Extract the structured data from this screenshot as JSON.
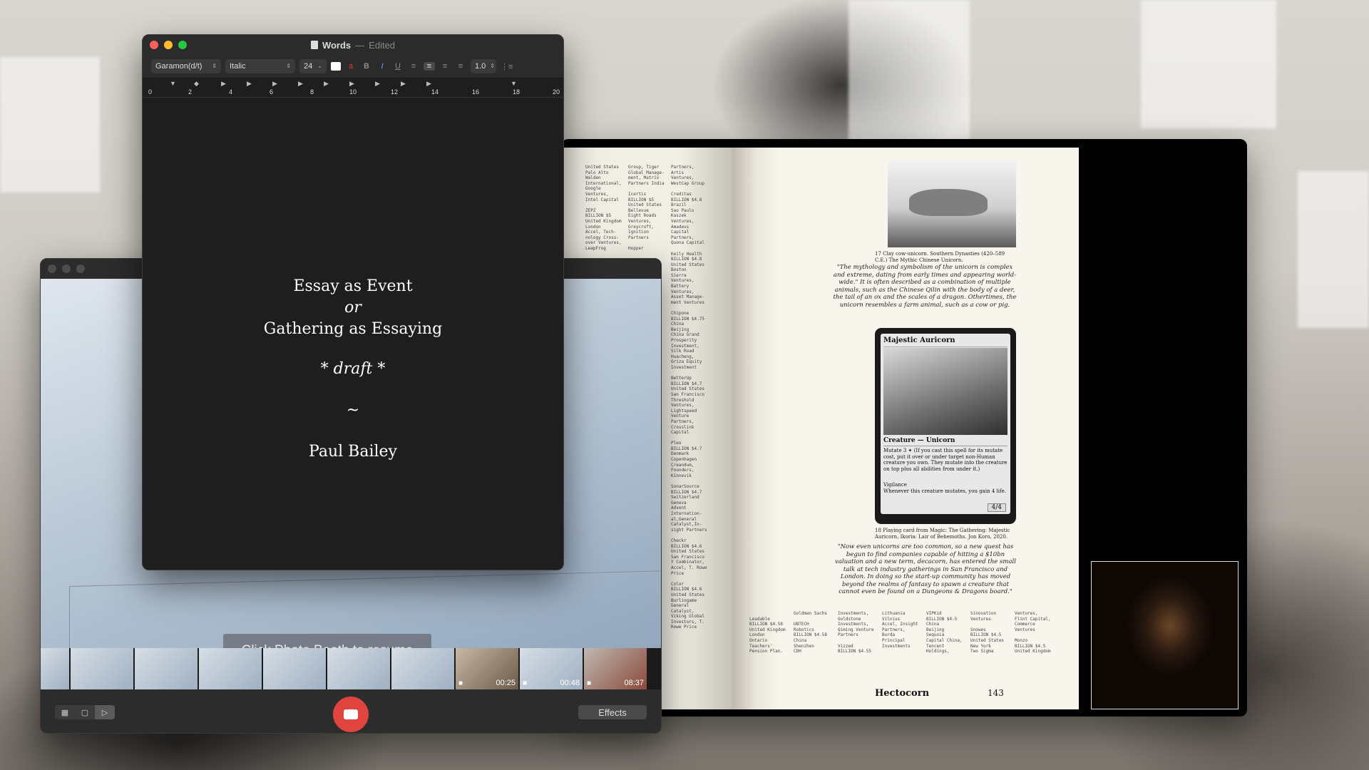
{
  "words": {
    "title": "Words",
    "separator": "—",
    "status": "Edited",
    "toolbar": {
      "font": "Garamon(d/t)",
      "style": "Italic",
      "size": "24",
      "bold": "B",
      "italic": "I",
      "underline": "U",
      "spacing": "1.0"
    },
    "ruler": [
      "0",
      "2",
      "4",
      "6",
      "8",
      "10",
      "12",
      "14",
      "16",
      "18",
      "20"
    ],
    "document": {
      "line1": "Essay as Event",
      "line2": "or",
      "line3": "Gathering as Essaying",
      "line4": "* draft *",
      "line5": "~",
      "line6": "Paul Bailey"
    }
  },
  "photobooth": {
    "resume_message": "Click Photo Booth to resume",
    "effects_label": "Effects",
    "thumbnails": [
      {
        "duration": ""
      },
      {
        "duration": ""
      },
      {
        "duration": ""
      },
      {
        "duration": ""
      },
      {
        "duration": ""
      },
      {
        "duration": ""
      },
      {
        "duration": ""
      },
      {
        "duration": "00:25"
      },
      {
        "duration": "00:48"
      },
      {
        "duration": "08:37"
      }
    ]
  },
  "book": {
    "left_columns": [
      "United States\nPalo Alto\nWalden\nInternational,\nGoogle\nVentures,\nIntel Capital\n\nZEPZ\nBILLION $5\nUnited Kingdom\nLondon\nAccel, Tech-\nnology Cross-\nover Ventures,\nLeapFrog",
      "Group, Tiger\nGlobal Manage-\nment, Matrix\nPartners India\n\nIcertis\nBILLION $5\nUnited States\nBellevue\nEight Roads\nVentures,\nGreycroft,\nIgnition\nPartners\n\nHopper",
      "Partners,\nArtis\nVentures,\nWestCap Group\n\nCreditas\nBILLION $4.8\nBrazil\nSao Paulo\nKaszek\nVentures,\nAmadeus\nCapital\nPartners,\nQuona Capital\n\nKeily Health\nBILLION $4.8\nUnited States\nBoston\nSierra\nVentures,\nBattery\nVentures,\nAsset Manage-\nment Ventures\n\nChipone\nBILLION $4.75\nChina\nBeijing\nChina Grand\nProsperity\nInvestment,\nSilk Road\nHuacheng,\nOriza Equity\nInvestment\n\nBetterUp\nBILLION $4.7\nUnited States\nSan Francisco\nThreshold\nVentures,\nLightspeed\nVenture\nPartners,\nCrosslink\nCapital\n\nPleo\nBILLION $4.7\nDenmark\nCopenhagen\nCreandum,\nFounders,\nKinnevik\n\nSonarSource\nBILLION $4.7\nSwitzerland\nGeneva\nAdvent\nInternation-\nal,General\nCatalyst,In-\nsight Partners\n\nCheckr\nBILLION $4.6\nUnited States\nSan Francisco\nY Combinator,\nAccel, T. Rowe\nPrice\n\nColor\nBILLION $4.6\nUnited States\nBurlingame\nGeneral\nCatalyst,\nViking Global\nInvestors, T.\nRowe Price"
    ],
    "figure17_caption": "17 Clay cow-unicorn. Southern Dynasties (420–589 C.E.) The Mythic Chinese Unicorn.",
    "quote1": "\"The mythology and symbolism of the unicorn is complex and extreme, dating from early times and appearing world-wide.\" It is often described as a combination of multiple animals, such as the Chinese Qilin with the body of a deer, the tail of an ox and the scales of a dragon. Othertimes, the unicorn resembles a farm animal, such as a cow or pig.",
    "card": {
      "name": "Majestic Auricorn",
      "type": "Creature — Unicorn",
      "rules": "Mutate 3 ✦ (If you cast this spell for its mutate cost, put it over or under target non-Human creature you own. They mutate into the creature on top plus all abilities from under it.)",
      "keyword": "Vigilance",
      "ability": "Whenever this creature mutates, you gain 4 life.",
      "pt": "4/4"
    },
    "figure18_caption": "18 Playing card from Magic: The Gathering: Majestic Auricorn, Ikoria: Lair of Behemoths. Jon Koro, 2020.",
    "quote2": "\"Now even unicorns are too common, so a new quest has begun to find companies capable of hitting a $10bn valuation and a new term, decacorn, has entered the small talk at tech industry gatherings in San Francisco and London. In doing so the start-up community has moved beyond the realms of fantasy to spawn a creature that cannot even be found on a Dungeons & Dragons board.\"",
    "bottom_columns": [
      "\nLeadable\nBILLION $4.58\nUnited Kingdom\nLondon\nOntario\nTeachers'\nPension Plan.",
      "Goldman Sachs\n\nUBTECH\nRobotics\nBILLION $4.58\nChina\nShenzhen\nCDH",
      "Investments,\nGoldstone\nInvestments,\nQiming Venture\nPartners\n\nVizzed\nBILLION $4.55",
      "Lithuania\nVilnius\nAccel, Insight\nPartners,\nBurda\nPrincipal\nInvestments",
      "VIPKid\nBILLION $4.5\nChina\nBeijing\nSequoia\nCapital China,\nTencent\nHoldings,",
      "Sinovation\nVentures\n\nSnowes\nBILLION $4.5\nUnited States\nNew York\nTwo Sigma",
      "Ventures,\nFlint Capital,\nCommerce\nVentures\n\nMonzo\nBILLION $4.5\nUnited Kingdom"
    ],
    "footer_title": "Hectocorn",
    "page_number": "143"
  }
}
